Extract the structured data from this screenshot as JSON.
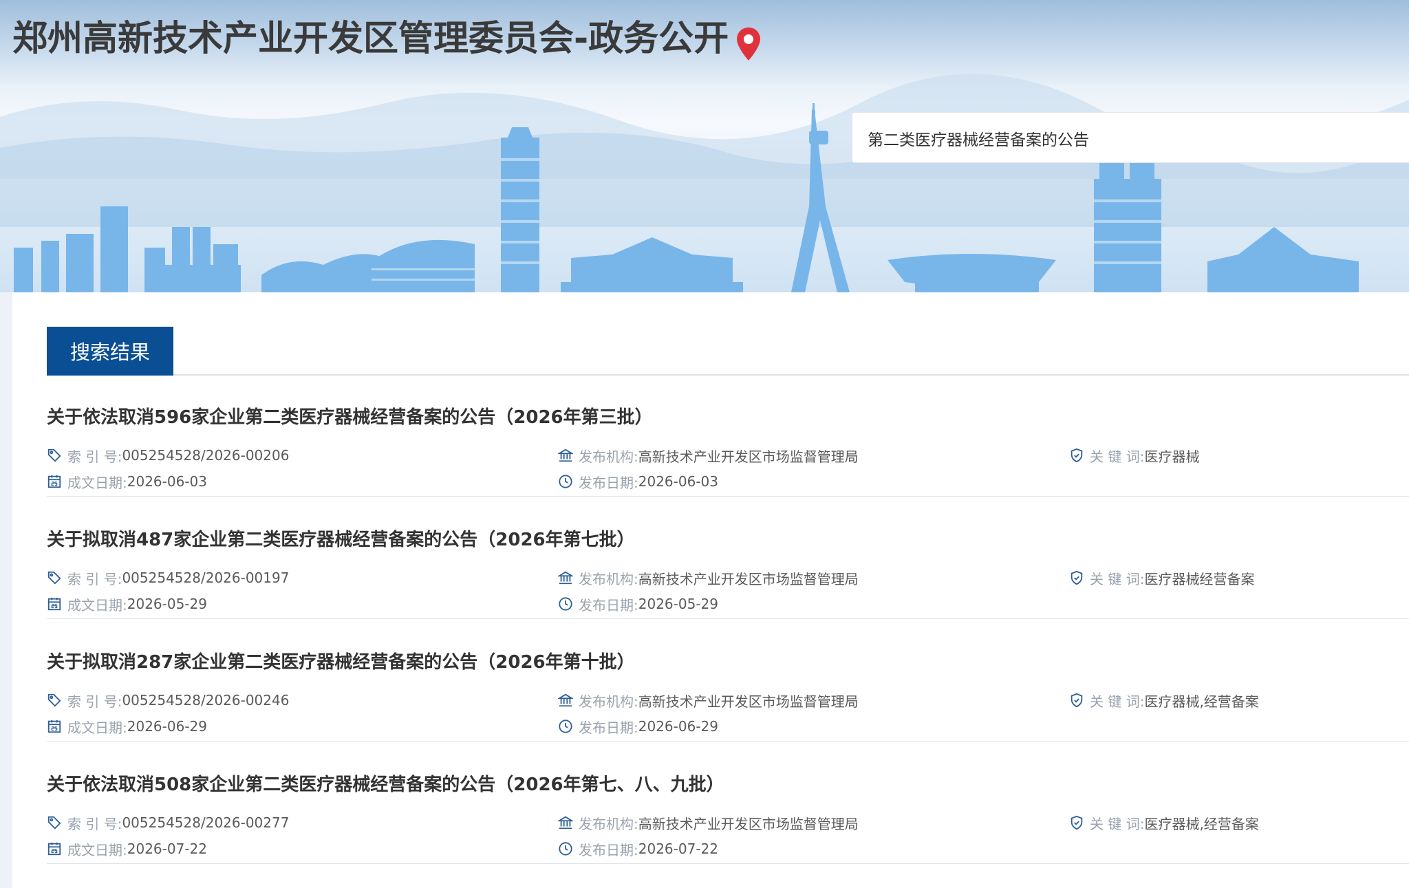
{
  "site": {
    "title": "郑州高新技术产业开发区管理委员会-政务公开"
  },
  "search": {
    "value": "第二类医疗器械经营备案的公告"
  },
  "tabs": {
    "active_label": "搜索结果"
  },
  "labels": {
    "index_no": "索 引 号:",
    "publisher": "发布机构:",
    "keywords": "关 键 词:",
    "doc_date": "成文日期:",
    "pub_date": "发布日期:"
  },
  "results": [
    {
      "title": "关于依法取消596家企业第二类医疗器械经营备案的公告（2026年第三批）",
      "index_no": "005254528/2026-00206",
      "publisher": "高新技术产业开发区市场监督管理局",
      "keywords": "医疗器械",
      "doc_date": "2026-06-03",
      "pub_date": "2026-06-03"
    },
    {
      "title": "关于拟取消487家企业第二类医疗器械经营备案的公告（2026年第七批）",
      "index_no": "005254528/2026-00197",
      "publisher": "高新技术产业开发区市场监督管理局",
      "keywords": "医疗器械经营备案",
      "doc_date": "2026-05-29",
      "pub_date": "2026-05-29"
    },
    {
      "title": "关于拟取消287家企业第二类医疗器械经营备案的公告（2026年第十批）",
      "index_no": "005254528/2026-00246",
      "publisher": "高新技术产业开发区市场监督管理局",
      "keywords": "医疗器械,经营备案",
      "doc_date": "2026-06-29",
      "pub_date": "2026-06-29"
    },
    {
      "title": "关于依法取消508家企业第二类医疗器械经营备案的公告（2026年第七、八、九批）",
      "index_no": "005254528/2026-00277",
      "publisher": "高新技术产业开发区市场监督管理局",
      "keywords": "医疗器械,经营备案",
      "doc_date": "2026-07-22",
      "pub_date": "2026-07-22"
    }
  ],
  "colors": {
    "accent": "#0a4f93",
    "pin": "#e0323c",
    "skyline": "#6aaee6"
  }
}
